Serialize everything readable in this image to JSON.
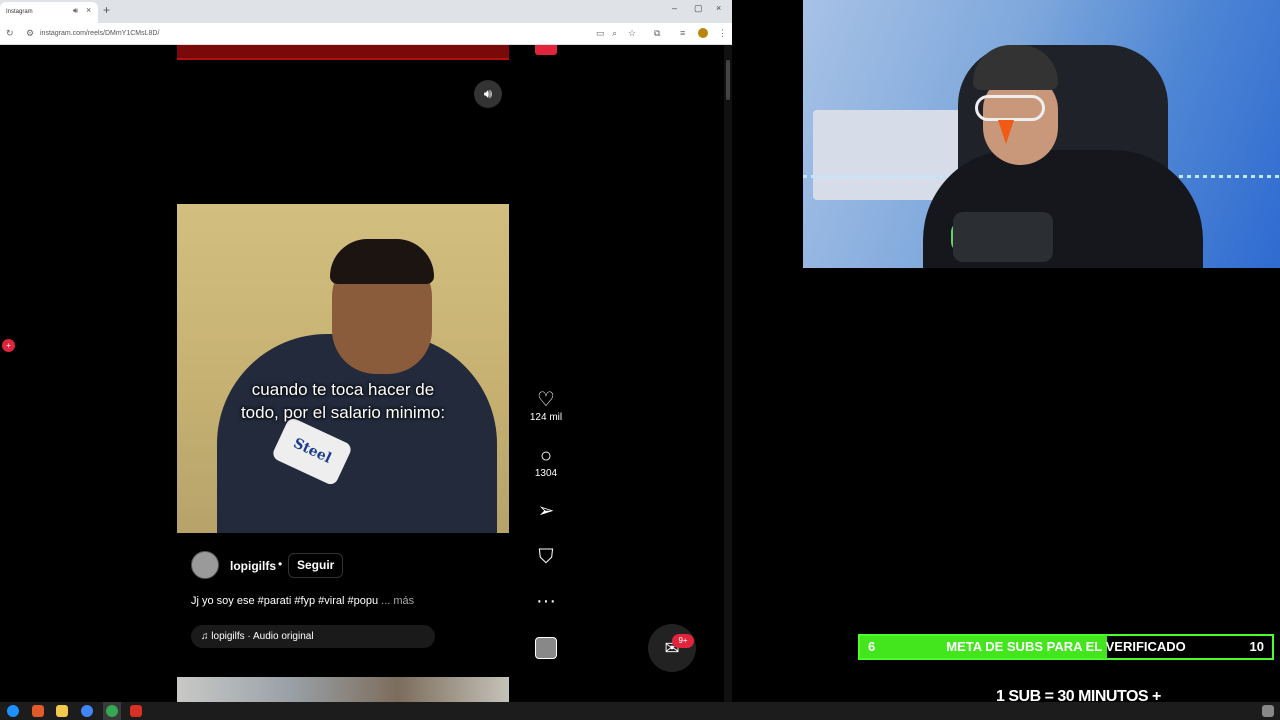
{
  "browser": {
    "tab_title": "Instagram",
    "tab_audio_icon": "speaker-icon",
    "tab_close": "×",
    "new_tab": "+",
    "window_controls": [
      "–",
      "▢",
      "×"
    ],
    "url": "instagram.com/reels/DMmY1CMsL8D/"
  },
  "reel": {
    "caption_line1": "cuando te toca hacer de",
    "caption_line2": "todo, por el salario minimo:",
    "mic_text": "Steel",
    "likes": "124 mil",
    "comments": "1304",
    "poster_name": "lopigilfs",
    "poster_separator": "•",
    "follow_label": "Seguir",
    "description": "Jj yo soy ese #parati #fyp #viral #popu",
    "description_more": "... más",
    "audio_label": "lopigilfs · Audio original",
    "messenger_badge": "9+",
    "left_notification": "+"
  },
  "overlay": {
    "goal_current": "6",
    "goal_label": "META DE SUBS PARA EL VERIFICADO",
    "goal_max": "10",
    "goal_progress": 0.6,
    "sub_rate": "1 SUB  =  30 MINUTOS +"
  },
  "colors": {
    "accent_red": "#e0243c",
    "goal_green": "#43e61d"
  }
}
